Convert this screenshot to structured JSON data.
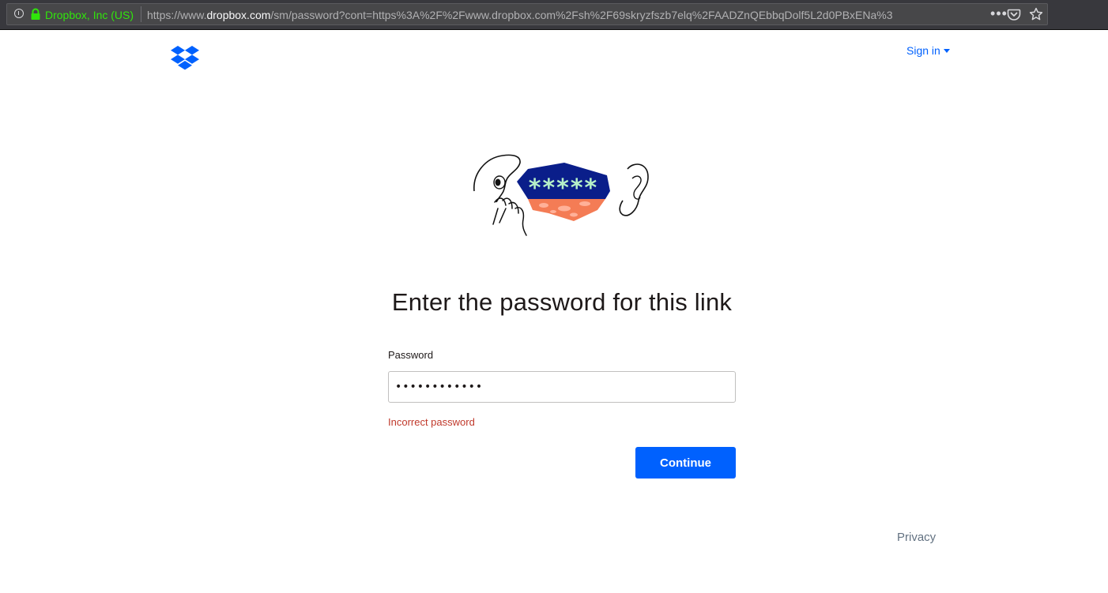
{
  "browser": {
    "site_identity": "Dropbox, Inc (US)",
    "url_prefix": "https://www.",
    "url_domain": "dropbox.com",
    "url_rest": "/sm/password?cont=https%3A%2F%2Fwww.dropbox.com%2Fsh%2F69skryzfszb7elq%2FAADZnQEbbqDolf5L2d0PBxENa%3",
    "page_actions_label": "•••",
    "icons": [
      "info-icon",
      "lock-icon",
      "pocket-icon",
      "star-icon"
    ],
    "identity_color": "#30e60b"
  },
  "header": {
    "logo_icon": "dropbox-logo-icon",
    "signin_label": "Sign in",
    "brand_color": "#0061fe"
  },
  "illustration": {
    "masked_text": "*****"
  },
  "main": {
    "title": "Enter the password for this link",
    "password_label": "Password",
    "password_value": "••••••••••••",
    "error_text": "Incorrect password",
    "error_color": "#c0392b",
    "continue_label": "Continue"
  },
  "footer": {
    "privacy_label": "Privacy"
  }
}
